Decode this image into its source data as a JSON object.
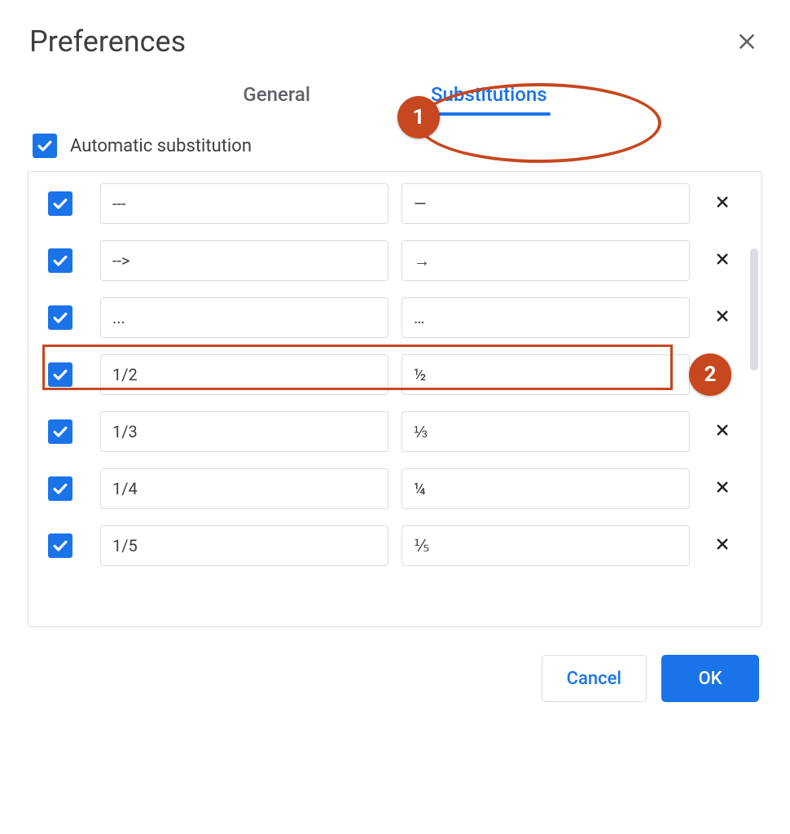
{
  "dialog": {
    "title": "Preferences"
  },
  "tabs": {
    "general": "General",
    "substitutions": "Substitutions",
    "active": "substitutions"
  },
  "auto_sub": {
    "label": "Automatic substitution",
    "checked": true
  },
  "rows": [
    {
      "checked": true,
      "replace": "---",
      "with": "—"
    },
    {
      "checked": true,
      "replace": "-->",
      "with": "→"
    },
    {
      "checked": true,
      "replace": "...",
      "with": "…"
    },
    {
      "checked": true,
      "replace": "1/2",
      "with": "½"
    },
    {
      "checked": true,
      "replace": "1/3",
      "with": "⅓"
    },
    {
      "checked": true,
      "replace": "1/4",
      "with": "¼"
    },
    {
      "checked": true,
      "replace": "1/5",
      "with": "⅕"
    }
  ],
  "footer": {
    "cancel": "Cancel",
    "ok": "OK"
  },
  "annotations": {
    "badge1": "1",
    "badge2": "2",
    "highlighted_row_index": 3
  },
  "colors": {
    "primary": "#1a73e8",
    "annotation": "#c7471f",
    "border": "#dadce0",
    "text": "#3c4043"
  }
}
